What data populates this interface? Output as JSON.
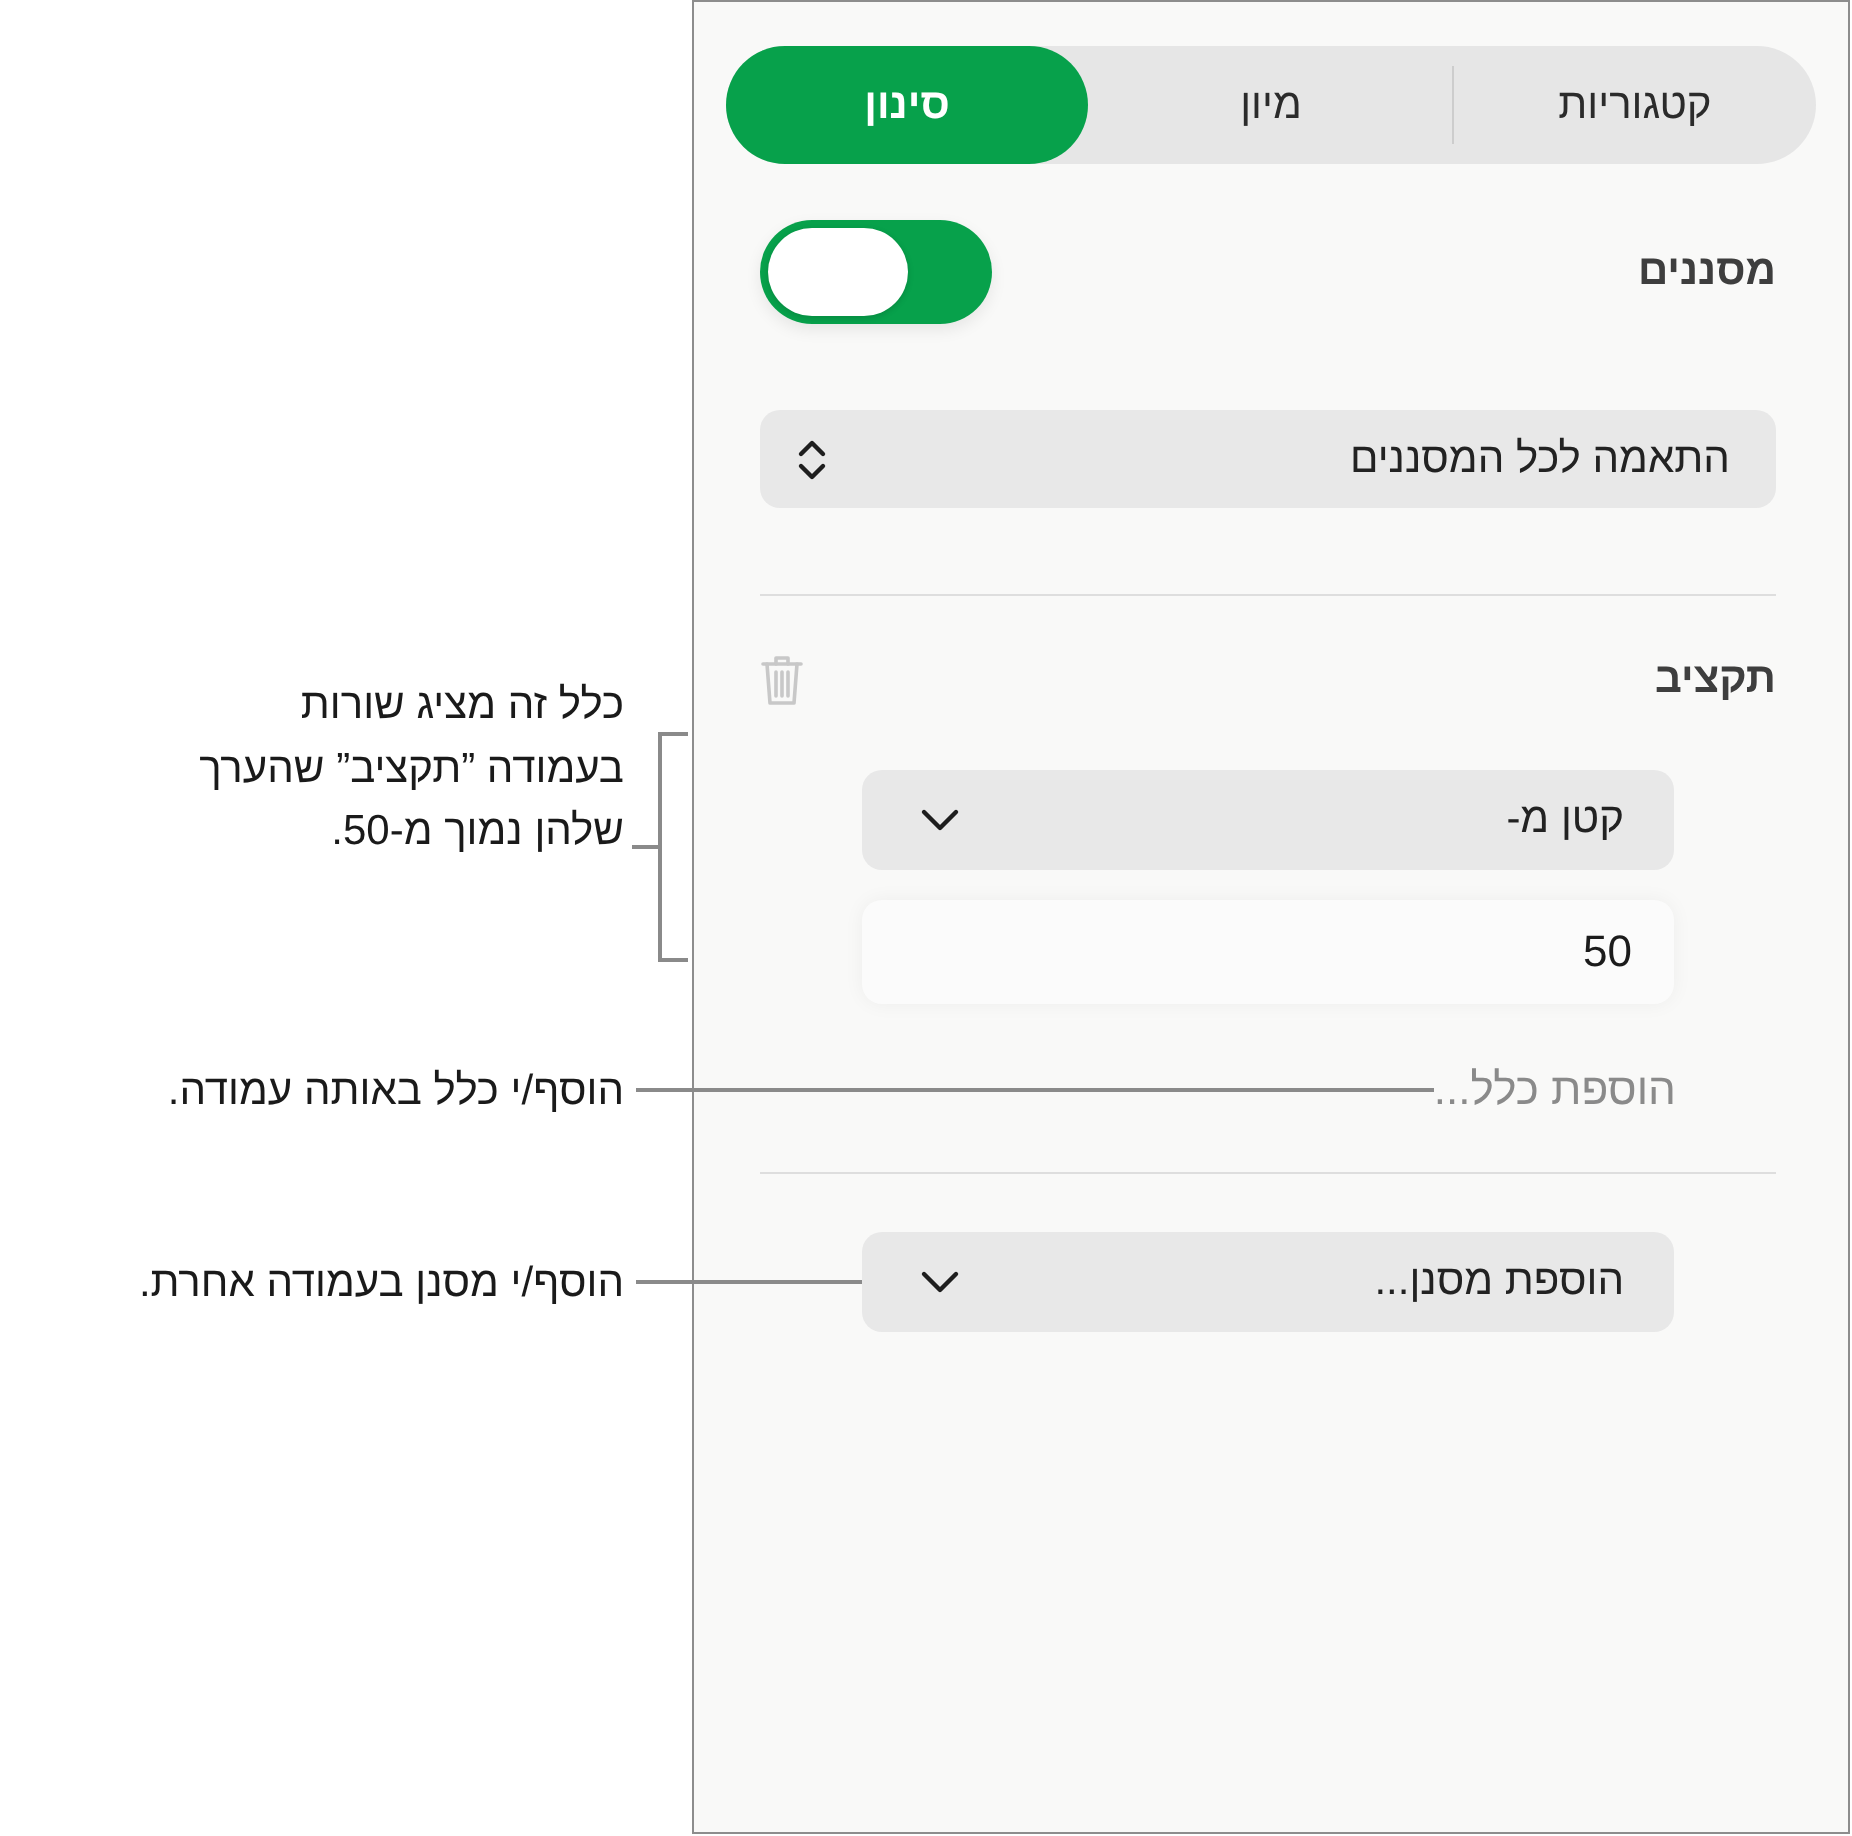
{
  "tabs": [
    {
      "label": "קטגוריות",
      "selected": false
    },
    {
      "label": "מיון",
      "selected": false
    },
    {
      "label": "סינון",
      "selected": true
    }
  ],
  "filters": {
    "label": "מסננים",
    "on": true
  },
  "match_popup": {
    "value": "התאמה לכל המסננים"
  },
  "rule_group": {
    "column": "תקציב",
    "condition": "קטן מ-",
    "value": "50",
    "callout": "כלל זה מציג שורות\nבעמודה ”תקציב” שהערך\nשלהן נמוך מ-50.",
    "add_rule": {
      "label": "הוספת כלל...",
      "callout": "הוסף/י כלל באותה עמודה."
    }
  },
  "add_filter": {
    "label": "הוספת מסנן...",
    "callout": "הוסף/י מסנן בעמודה אחרת."
  }
}
